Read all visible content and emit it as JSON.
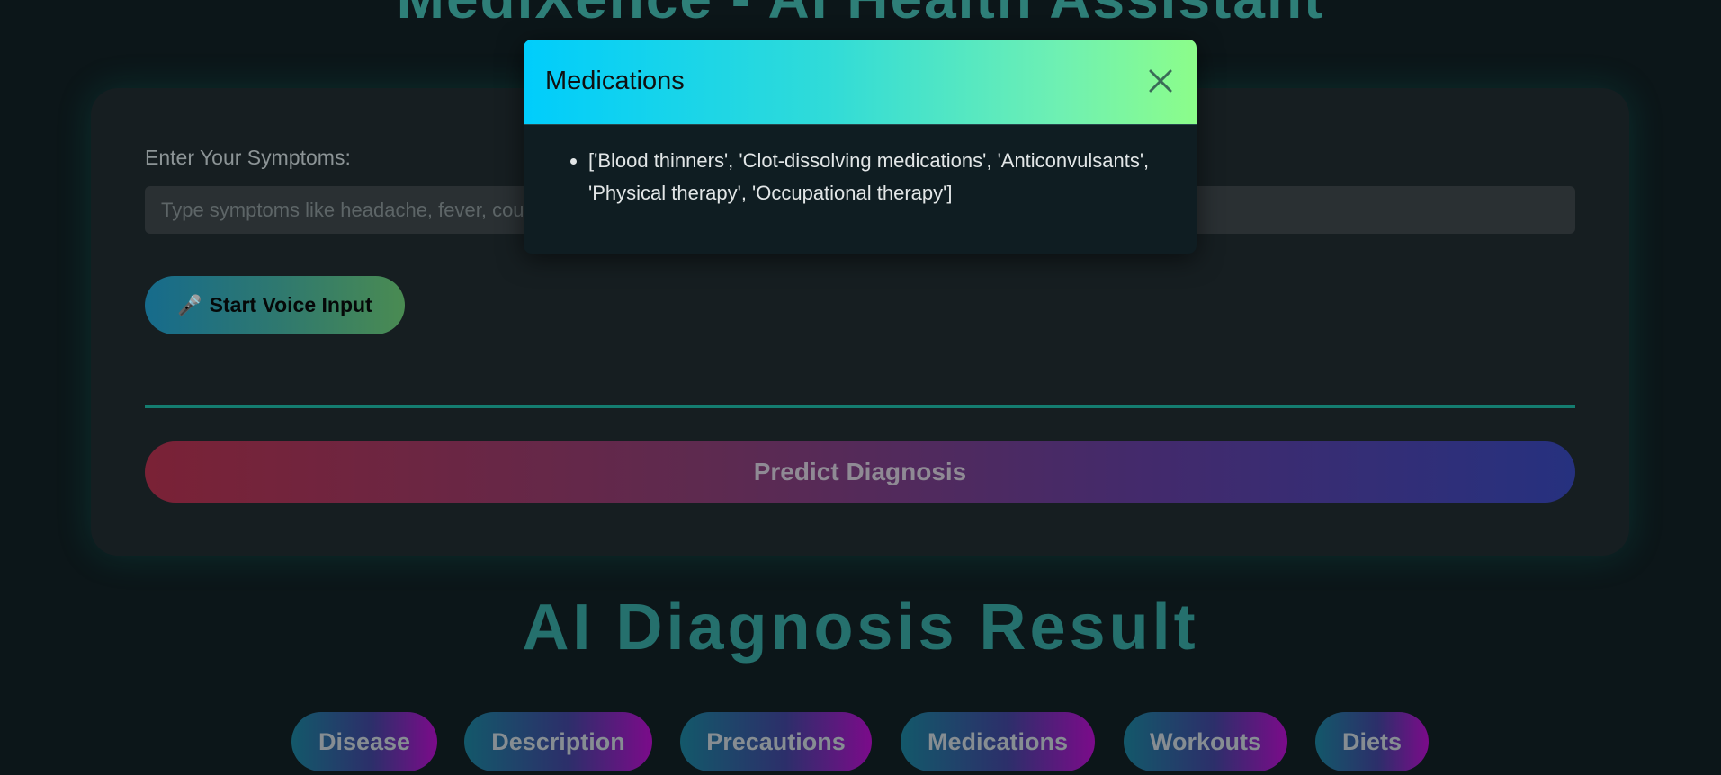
{
  "app": {
    "title": "MediXence - AI Health Assistant"
  },
  "symptoms": {
    "label": "Enter Your Symptoms:",
    "placeholder": "Type symptoms like headache, fever, cough...",
    "value": ""
  },
  "voice_button": {
    "label": "Start Voice Input",
    "icon": "microphone-icon"
  },
  "predict_button": {
    "label": "Predict Diagnosis"
  },
  "result": {
    "title": "AI Diagnosis Result",
    "tabs": [
      {
        "label": "Disease"
      },
      {
        "label": "Description"
      },
      {
        "label": "Precautions"
      },
      {
        "label": "Medications"
      },
      {
        "label": "Workouts"
      },
      {
        "label": "Diets"
      }
    ]
  },
  "modal": {
    "title": "Medications",
    "close_icon": "close-icon",
    "items": [
      "['Blood thinners', 'Clot-dissolving medications', 'Anticonvulsants', 'Physical therapy', 'Occupational therapy']"
    ]
  },
  "colors": {
    "background": "#0c1619",
    "accent_teal": "#2e7f78",
    "modal_header_start": "#00cdfc",
    "modal_header_end": "#8cfd8a"
  }
}
